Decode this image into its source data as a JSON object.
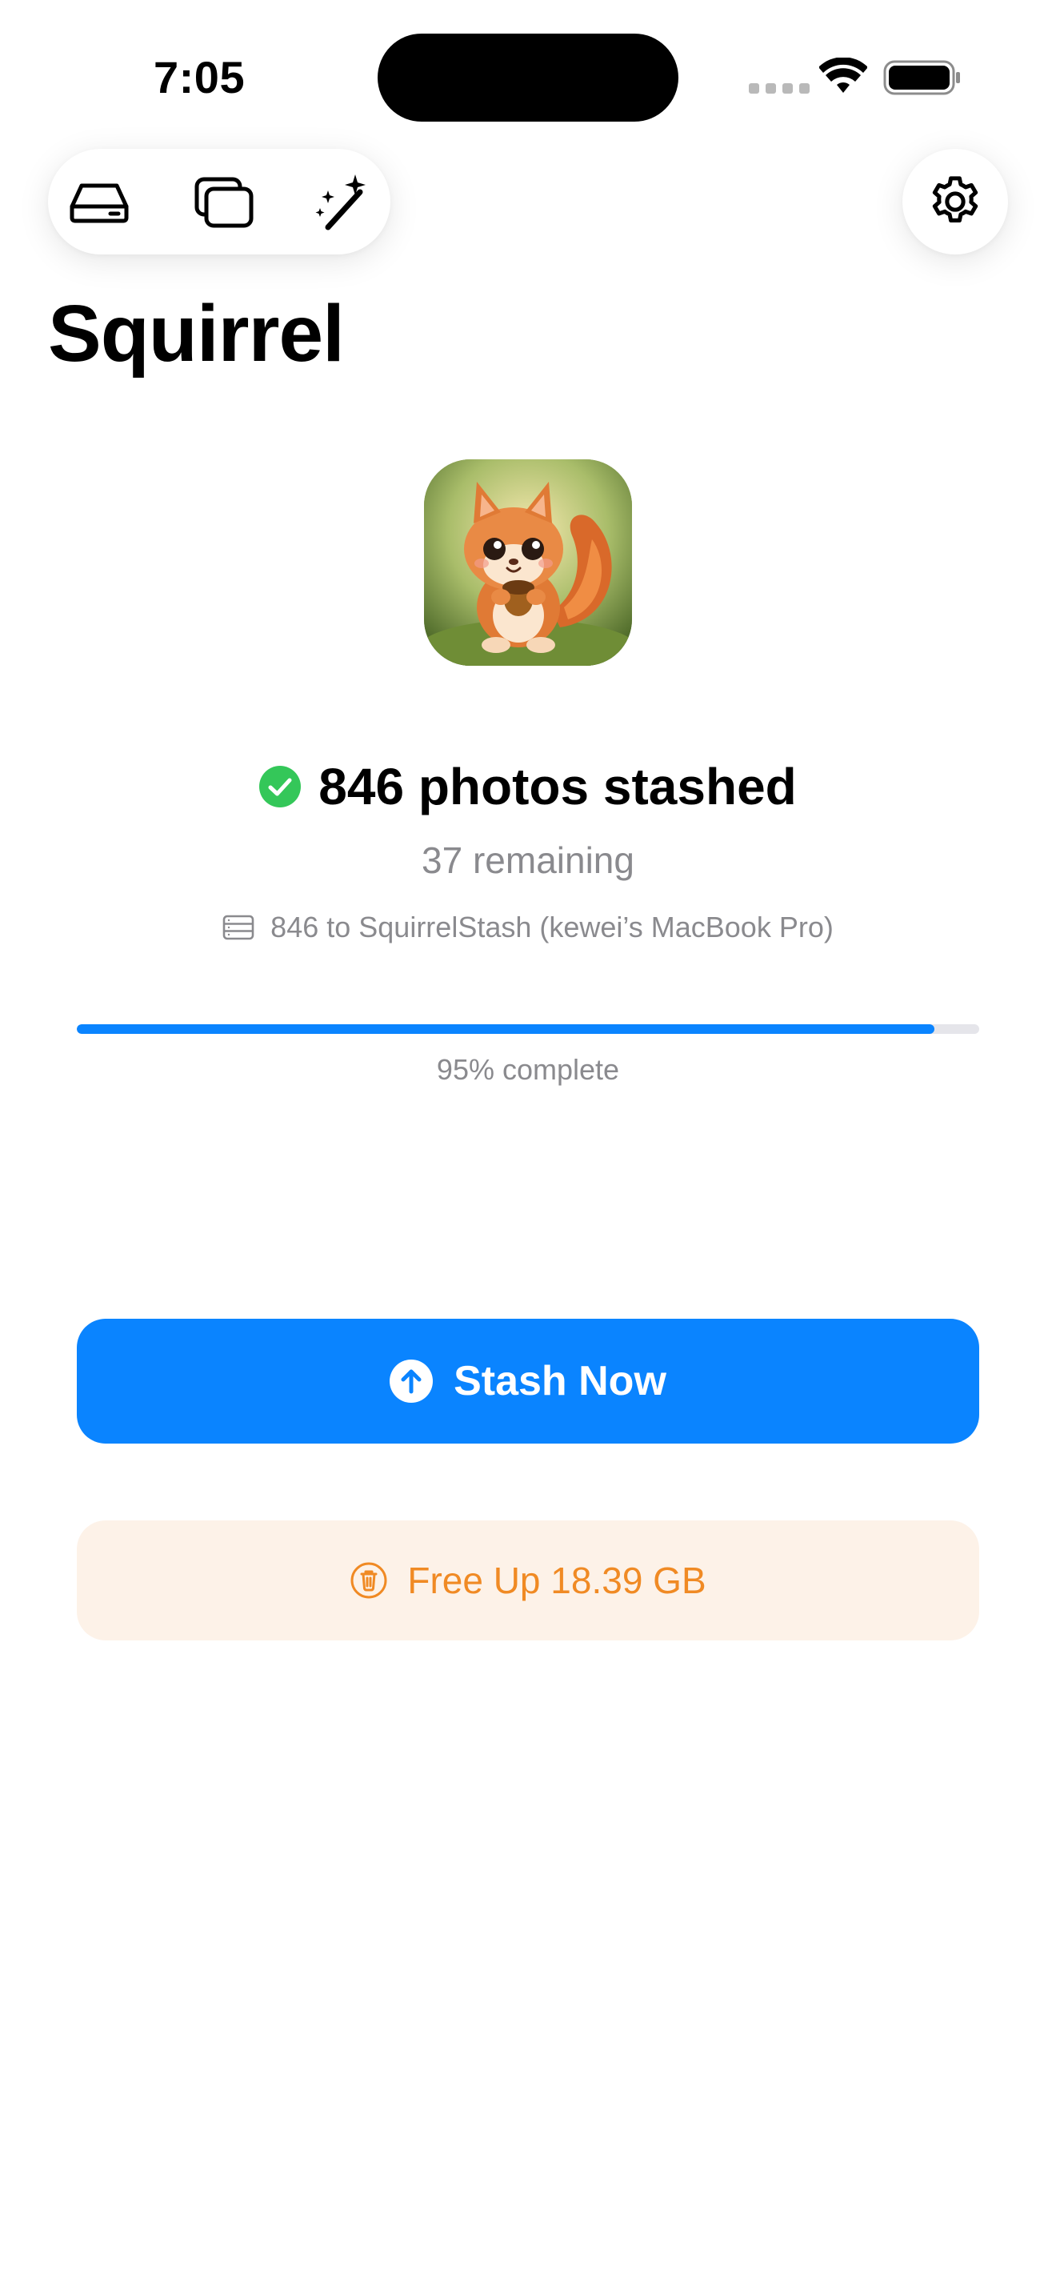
{
  "status_bar": {
    "time": "7:05",
    "icons": [
      "cellular-icon",
      "wifi-icon",
      "battery-icon"
    ]
  },
  "toolbar": {
    "left_icons": [
      "drive-icon",
      "photos-icon",
      "magic-wand-icon"
    ],
    "right_icon": "gear-icon"
  },
  "page": {
    "title": "Squirrel"
  },
  "app_icon": {
    "name": "squirrel-mascot-icon"
  },
  "stats": {
    "stashed": "846 photos stashed",
    "remaining": "37 remaining",
    "destination": "846 to SquirrelStash (kewei’s MacBook Pro)"
  },
  "progress": {
    "value": 0.95,
    "label": "95% complete"
  },
  "actions": {
    "stash_now": "Stash Now",
    "free_up": "Free Up 18.39 GB"
  },
  "colors": {
    "accent": "#0a84ff",
    "success": "#34c759",
    "warning": "#f08a24",
    "warning_bg": "#fdf2e8",
    "secondary_text": "#8a8a8e"
  }
}
